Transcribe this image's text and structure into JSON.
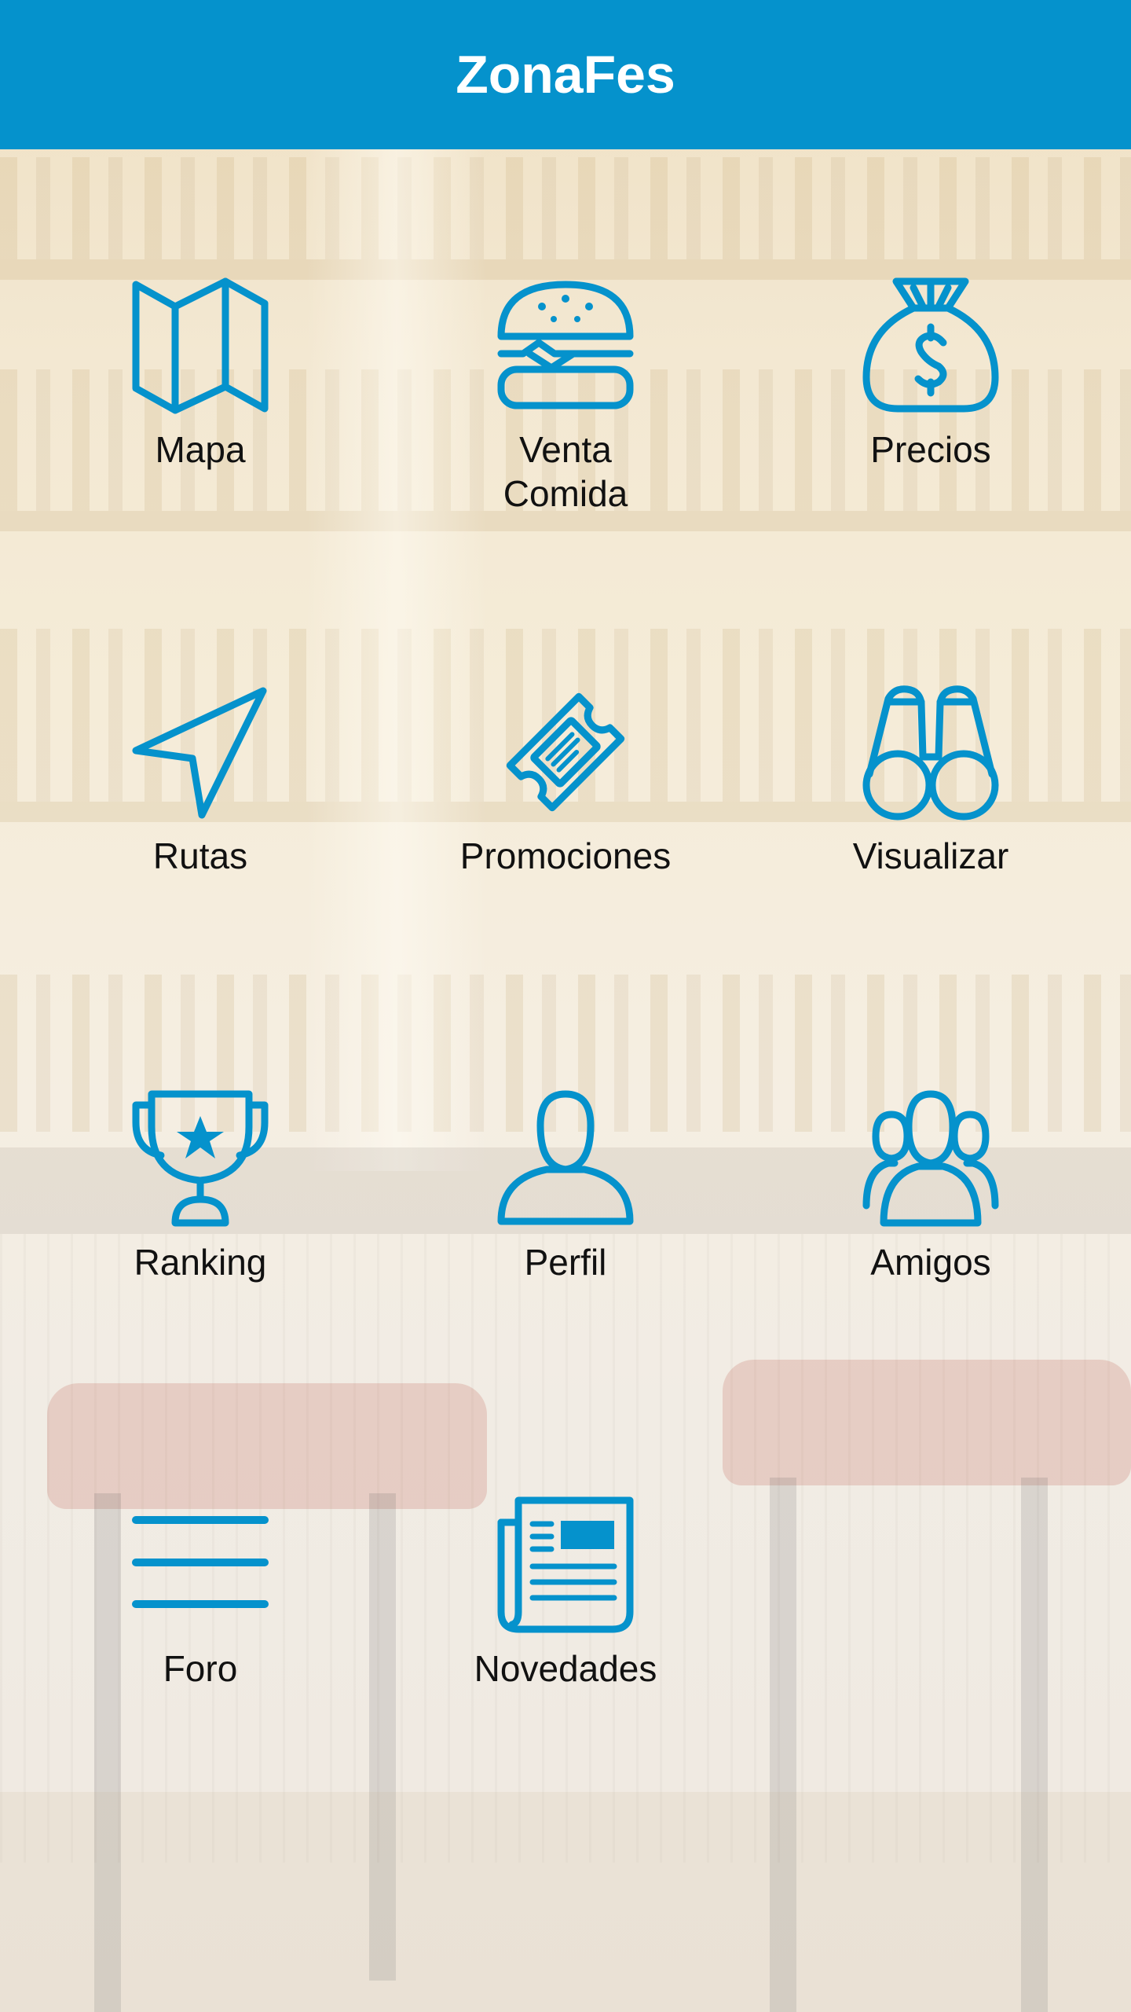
{
  "app": {
    "title": "ZonaFes",
    "accent_color": "#0592cc"
  },
  "menu": [
    {
      "label": "Mapa",
      "icon": "map-icon"
    },
    {
      "label": "Venta\nComida",
      "icon": "burger-icon"
    },
    {
      "label": "Precios",
      "icon": "money-bag-icon"
    },
    {
      "label": "Rutas",
      "icon": "navigation-arrow-icon"
    },
    {
      "label": "Promociones",
      "icon": "ticket-icon"
    },
    {
      "label": "Visualizar",
      "icon": "binoculars-icon"
    },
    {
      "label": "Ranking",
      "icon": "trophy-icon"
    },
    {
      "label": "Perfil",
      "icon": "user-icon"
    },
    {
      "label": "Amigos",
      "icon": "group-icon"
    },
    {
      "label": "Foro",
      "icon": "menu-lines-icon"
    },
    {
      "label": "Novedades",
      "icon": "newspaper-icon"
    }
  ]
}
